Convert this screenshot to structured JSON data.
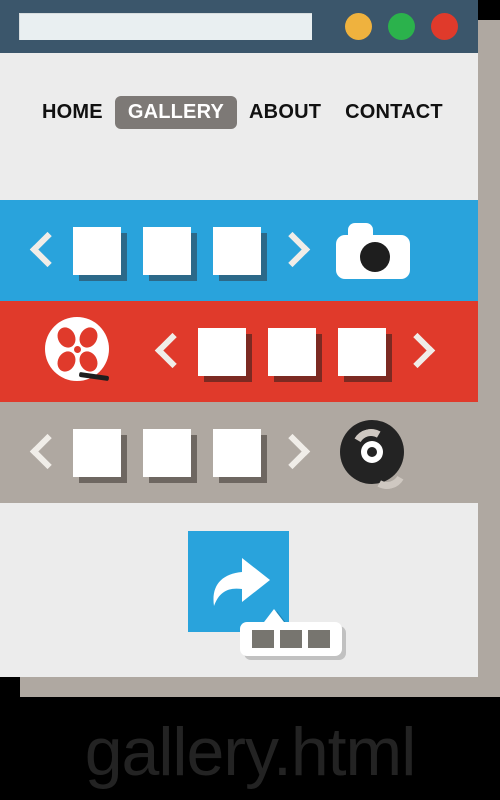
{
  "browser": {
    "url_value": "",
    "url_placeholder": "",
    "window_buttons": [
      {
        "name": "minimize",
        "color": "#EFB23E"
      },
      {
        "name": "maximize",
        "color": "#2BB24C"
      },
      {
        "name": "close",
        "color": "#E03A2B"
      }
    ]
  },
  "nav": {
    "items": [
      {
        "label": "HOME",
        "active": false
      },
      {
        "label": "GALLERY",
        "active": true
      },
      {
        "label": "ABOUT",
        "active": false
      },
      {
        "label": "CONTACT",
        "active": false
      }
    ]
  },
  "bands": [
    {
      "id": "photos",
      "color": "#29A3DC",
      "icon": "camera-icon",
      "icon_side": "right",
      "prev_label": "‹",
      "next_label": "›",
      "thumbnails": [
        "",
        "",
        ""
      ]
    },
    {
      "id": "videos",
      "color": "#E03A2B",
      "icon": "film-reel-icon",
      "icon_side": "left",
      "prev_label": "‹",
      "next_label": "›",
      "thumbnails": [
        "",
        "",
        ""
      ]
    },
    {
      "id": "audio",
      "color": "#AFA8A1",
      "icon": "vinyl-record-icon",
      "icon_side": "right",
      "prev_label": "‹",
      "next_label": "›",
      "thumbnails": [
        "",
        "",
        ""
      ]
    }
  ],
  "content": {
    "share_tile": {
      "icon": "share-arrow-icon",
      "color": "#29A3DC"
    },
    "cursor_popup": {
      "icon": "cursor-pointer-icon",
      "blocks": [
        "",
        "",
        ""
      ]
    }
  },
  "caption": {
    "filename": "gallery.html"
  },
  "palette": {
    "titlebar": "#3B566B",
    "page_background": "#ECECEC",
    "blue": "#29A3DC",
    "red": "#E03A2B",
    "warm_gray": "#AFA8A1",
    "active_nav": "#7D7976",
    "canvas": "#000000"
  }
}
